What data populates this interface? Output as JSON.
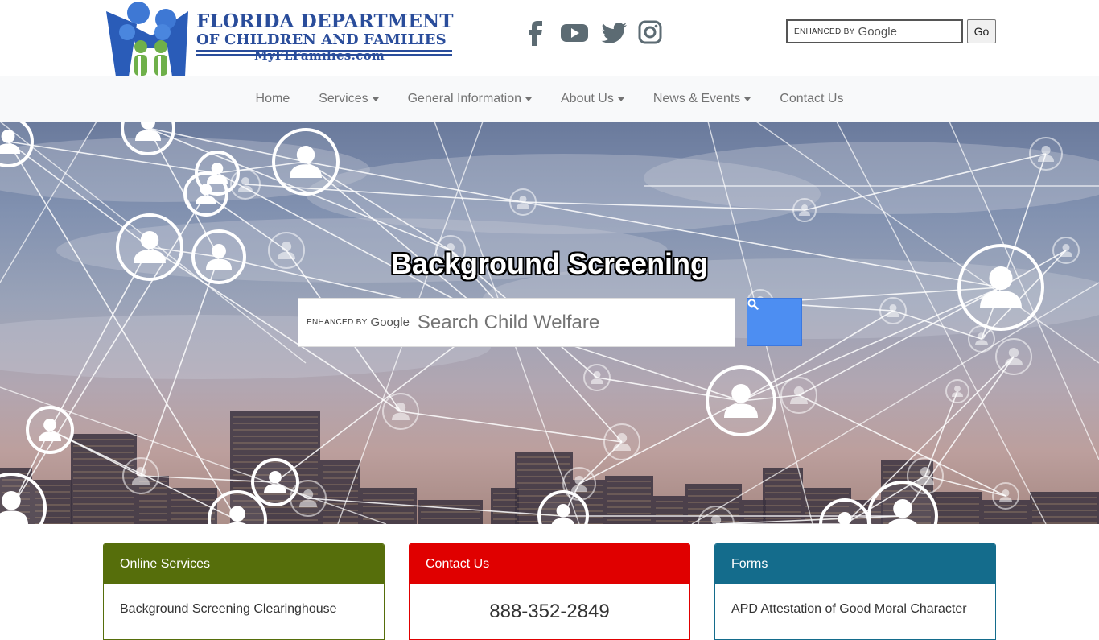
{
  "header": {
    "logo": {
      "line1": "FLORIDA DEPARTMENT",
      "line2": "OF CHILDREN AND FAMILIES",
      "line3": "MyFLFamilies.com"
    },
    "social_icons": [
      "facebook-icon",
      "youtube-icon",
      "twitter-icon",
      "instagram-icon"
    ],
    "search": {
      "enhanced_by": "ENHANCED BY",
      "brand": "Google",
      "button_label": "Go"
    }
  },
  "nav": {
    "items": [
      {
        "label": "Home",
        "dropdown": false
      },
      {
        "label": "Services",
        "dropdown": true
      },
      {
        "label": "General Information",
        "dropdown": true
      },
      {
        "label": "About Us",
        "dropdown": true
      },
      {
        "label": "News & Events",
        "dropdown": true
      },
      {
        "label": "Contact Us",
        "dropdown": false
      }
    ]
  },
  "hero": {
    "title": "Background Screening",
    "search": {
      "enhanced_by": "ENHANCED BY",
      "brand": "Google",
      "placeholder": "Search Child Welfare",
      "button_icon": "search-icon"
    }
  },
  "cards": [
    {
      "title": "Online Services",
      "body": "Background Screening Clearinghouse",
      "color": "#566e0b"
    },
    {
      "title": "Contact Us",
      "body": "888-352-2849",
      "color": "#e00000"
    },
    {
      "title": "Forms",
      "body": "APD Attestation of Good Moral Character",
      "color": "#146c8c"
    }
  ],
  "colors": {
    "nav_bg": "#f8f9fa",
    "nav_text": "#737373",
    "logo_blue": "#2a4d9b",
    "search_button": "#4d8ef2"
  }
}
